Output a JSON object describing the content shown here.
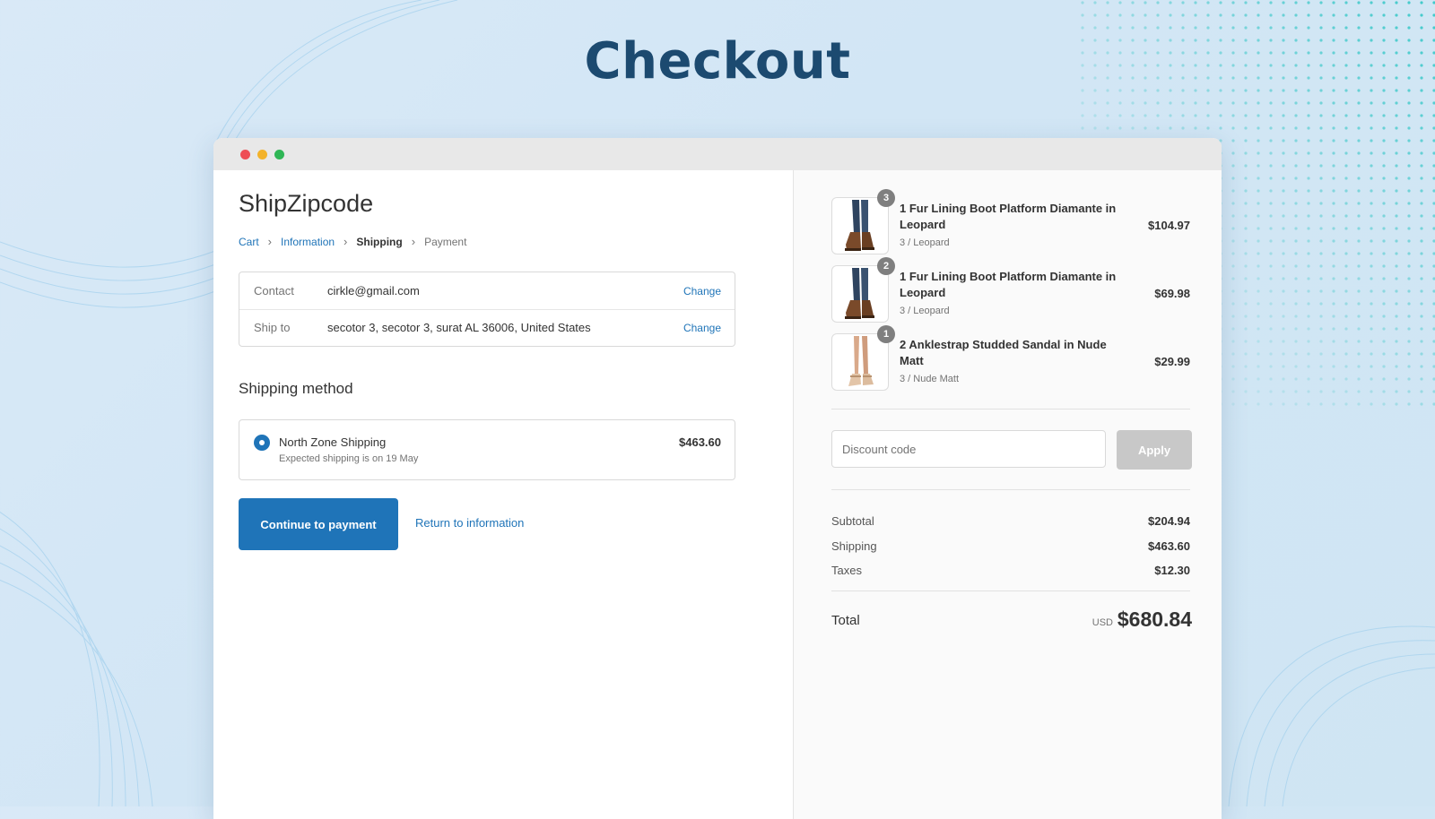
{
  "page": {
    "headline": "Checkout"
  },
  "store": {
    "name": "ShipZipcode"
  },
  "breadcrumb": [
    {
      "label": "Cart",
      "state": "link"
    },
    {
      "label": "Information",
      "state": "link"
    },
    {
      "label": "Shipping",
      "state": "current"
    },
    {
      "label": "Payment",
      "state": "upcoming"
    }
  ],
  "review": {
    "contact": {
      "label": "Contact",
      "value": "cirkle@gmail.com",
      "action": "Change"
    },
    "ship_to": {
      "label": "Ship to",
      "value": "secotor 3, secotor 3, surat AL 36006, United States",
      "action": "Change"
    }
  },
  "shipping_method": {
    "title": "Shipping method",
    "option": {
      "name": "North Zone Shipping",
      "note": "Expected shipping is on 19 May",
      "price": "$463.60",
      "selected": true
    }
  },
  "actions": {
    "continue_label": "Continue to payment",
    "return_label": "Return to information"
  },
  "cart": {
    "items": [
      {
        "quantity": "3",
        "title": "1 Fur Lining Boot Platform Diamante in Leopard",
        "variant": "3 / Leopard",
        "price": "$104.97",
        "image": "boot-product-photo"
      },
      {
        "quantity": "2",
        "title": "1 Fur Lining Boot Platform Diamante in Leopard",
        "variant": "3 / Leopard",
        "price": "$69.98",
        "image": "boot-product-photo"
      },
      {
        "quantity": "1",
        "title": "2 Anklestrap Studded Sandal in Nude Matt",
        "variant": "3 / Nude Matt",
        "price": "$29.99",
        "image": "sandal-product-photo"
      }
    ]
  },
  "discount": {
    "placeholder": "Discount code",
    "apply_label": "Apply"
  },
  "summary": {
    "subtotal": {
      "label": "Subtotal",
      "value": "$204.94"
    },
    "shipping": {
      "label": "Shipping",
      "value": "$463.60"
    },
    "taxes": {
      "label": "Taxes",
      "value": "$12.30"
    },
    "total": {
      "label": "Total",
      "currency": "USD",
      "value": "$680.84"
    }
  },
  "colors": {
    "accent": "#1f74b8",
    "headline": "#1c4a70",
    "apply_disabled": "#c8c8c8"
  }
}
